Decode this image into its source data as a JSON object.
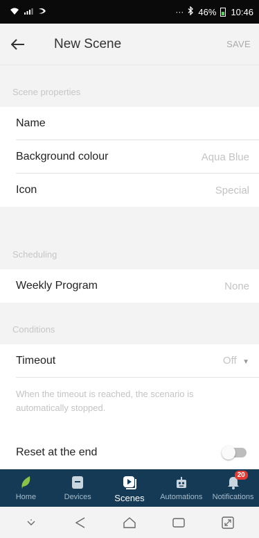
{
  "status_bar": {
    "left_icons": [
      "wifi-icon",
      "signal-icon",
      "cast-icon"
    ],
    "dots": "···",
    "battery_percent": "46%",
    "time": "10:46"
  },
  "header": {
    "title": "New Scene",
    "save_label": "SAVE"
  },
  "sections": {
    "properties": {
      "header": "Scene properties",
      "name_label": "Name",
      "background_label": "Background colour",
      "background_value": "Aqua Blue",
      "icon_label": "Icon",
      "icon_value": "Special"
    },
    "scheduling": {
      "header": "Scheduling",
      "weekly_label": "Weekly Program",
      "weekly_value": "None"
    },
    "conditions": {
      "header": "Conditions",
      "timeout_label": "Timeout",
      "timeout_value": "Off",
      "help_text": "When the timeout is reached, the scenario is automatically stopped.",
      "reset_label": "Reset at the end",
      "reset_on": false
    }
  },
  "bottom_nav": {
    "home": "Home",
    "devices": "Devices",
    "scenes": "Scenes",
    "automations": "Automations",
    "notifications": "Notifications",
    "notification_count": "20",
    "active": "Scenes"
  },
  "colors": {
    "nav_background": "#143a55",
    "leaf_green": "#8bc34a",
    "badge_red": "#e53935"
  }
}
